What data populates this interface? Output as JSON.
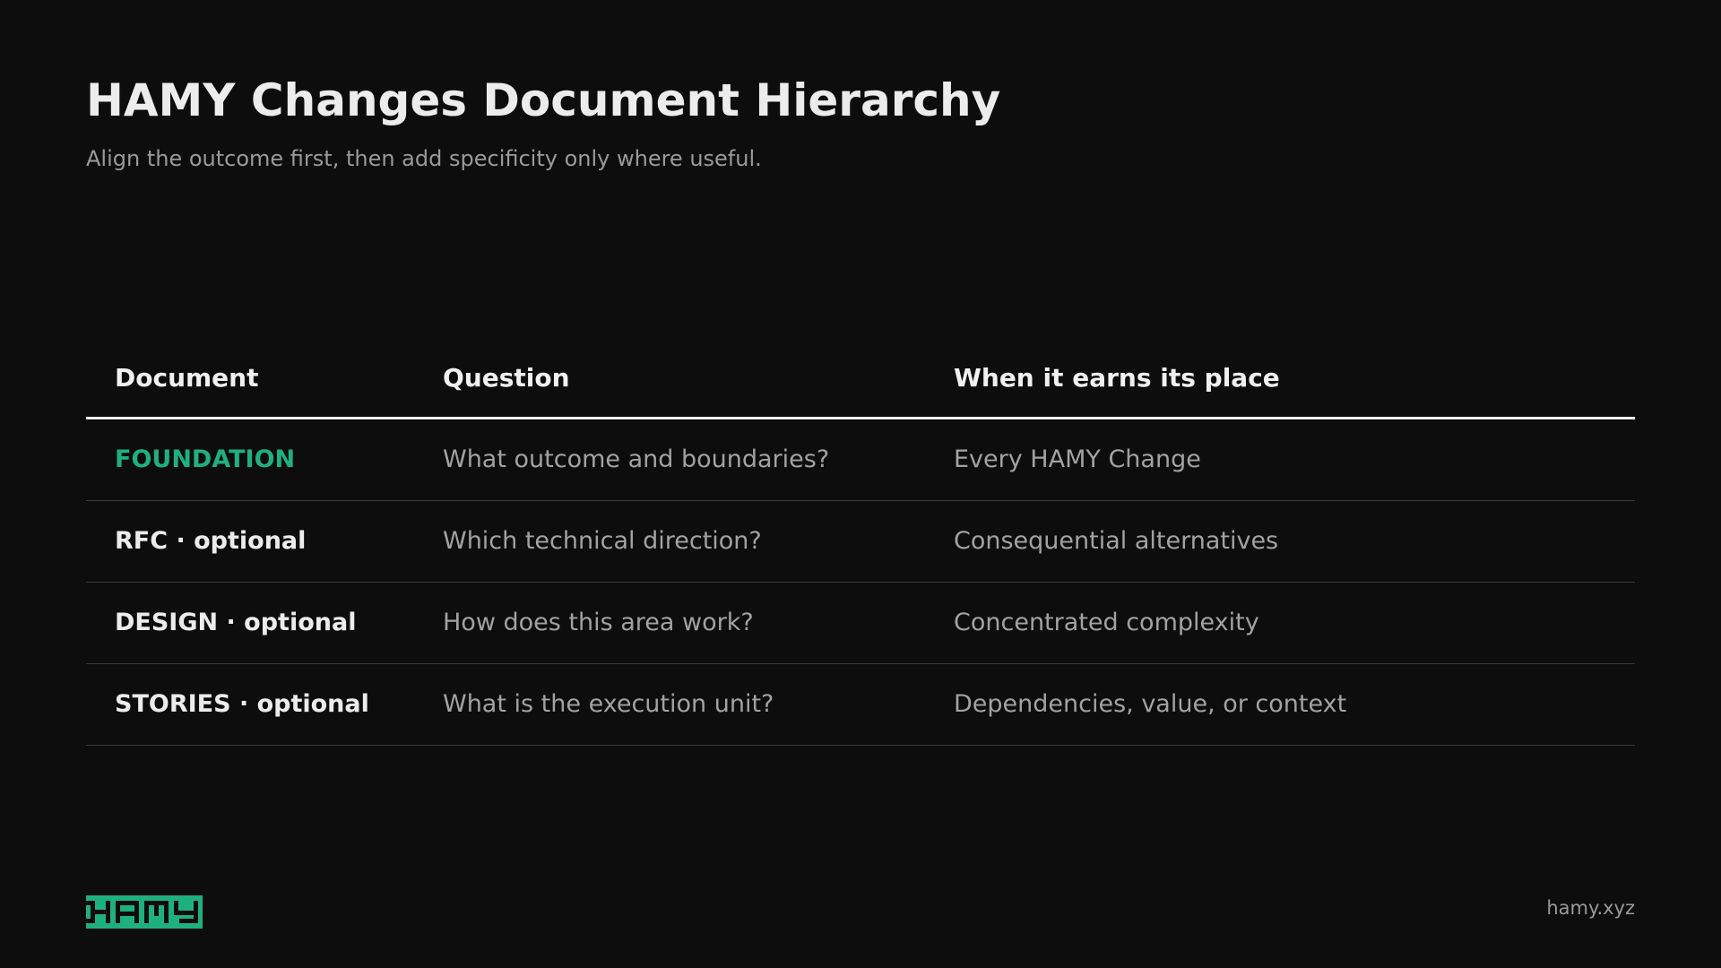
{
  "header": {
    "title": "HAMY Changes Document Hierarchy",
    "subtitle": "Align the outcome first, then add specificity only where useful."
  },
  "table": {
    "columns": [
      "Document",
      "Question",
      "When it earns its place"
    ],
    "rows": [
      {
        "document": "FOUNDATION",
        "question": "What outcome and boundaries?",
        "when": "Every HAMY Change",
        "accent": true
      },
      {
        "document": "RFC · optional",
        "question": "Which technical direction?",
        "when": "Consequential alternatives",
        "accent": false
      },
      {
        "document": "DESIGN · optional",
        "question": "How does this area work?",
        "when": "Concentrated complexity",
        "accent": false
      },
      {
        "document": "STORIES · optional",
        "question": "What is the execution unit?",
        "when": "Dependencies, value, or context",
        "accent": false
      }
    ]
  },
  "footer": {
    "logo_text": "HAMY",
    "url": "hamy.xyz"
  },
  "colors": {
    "background": "#0d0d0d",
    "accent": "#1fb07f",
    "text": "#ececec",
    "muted": "#a2a2a2"
  }
}
